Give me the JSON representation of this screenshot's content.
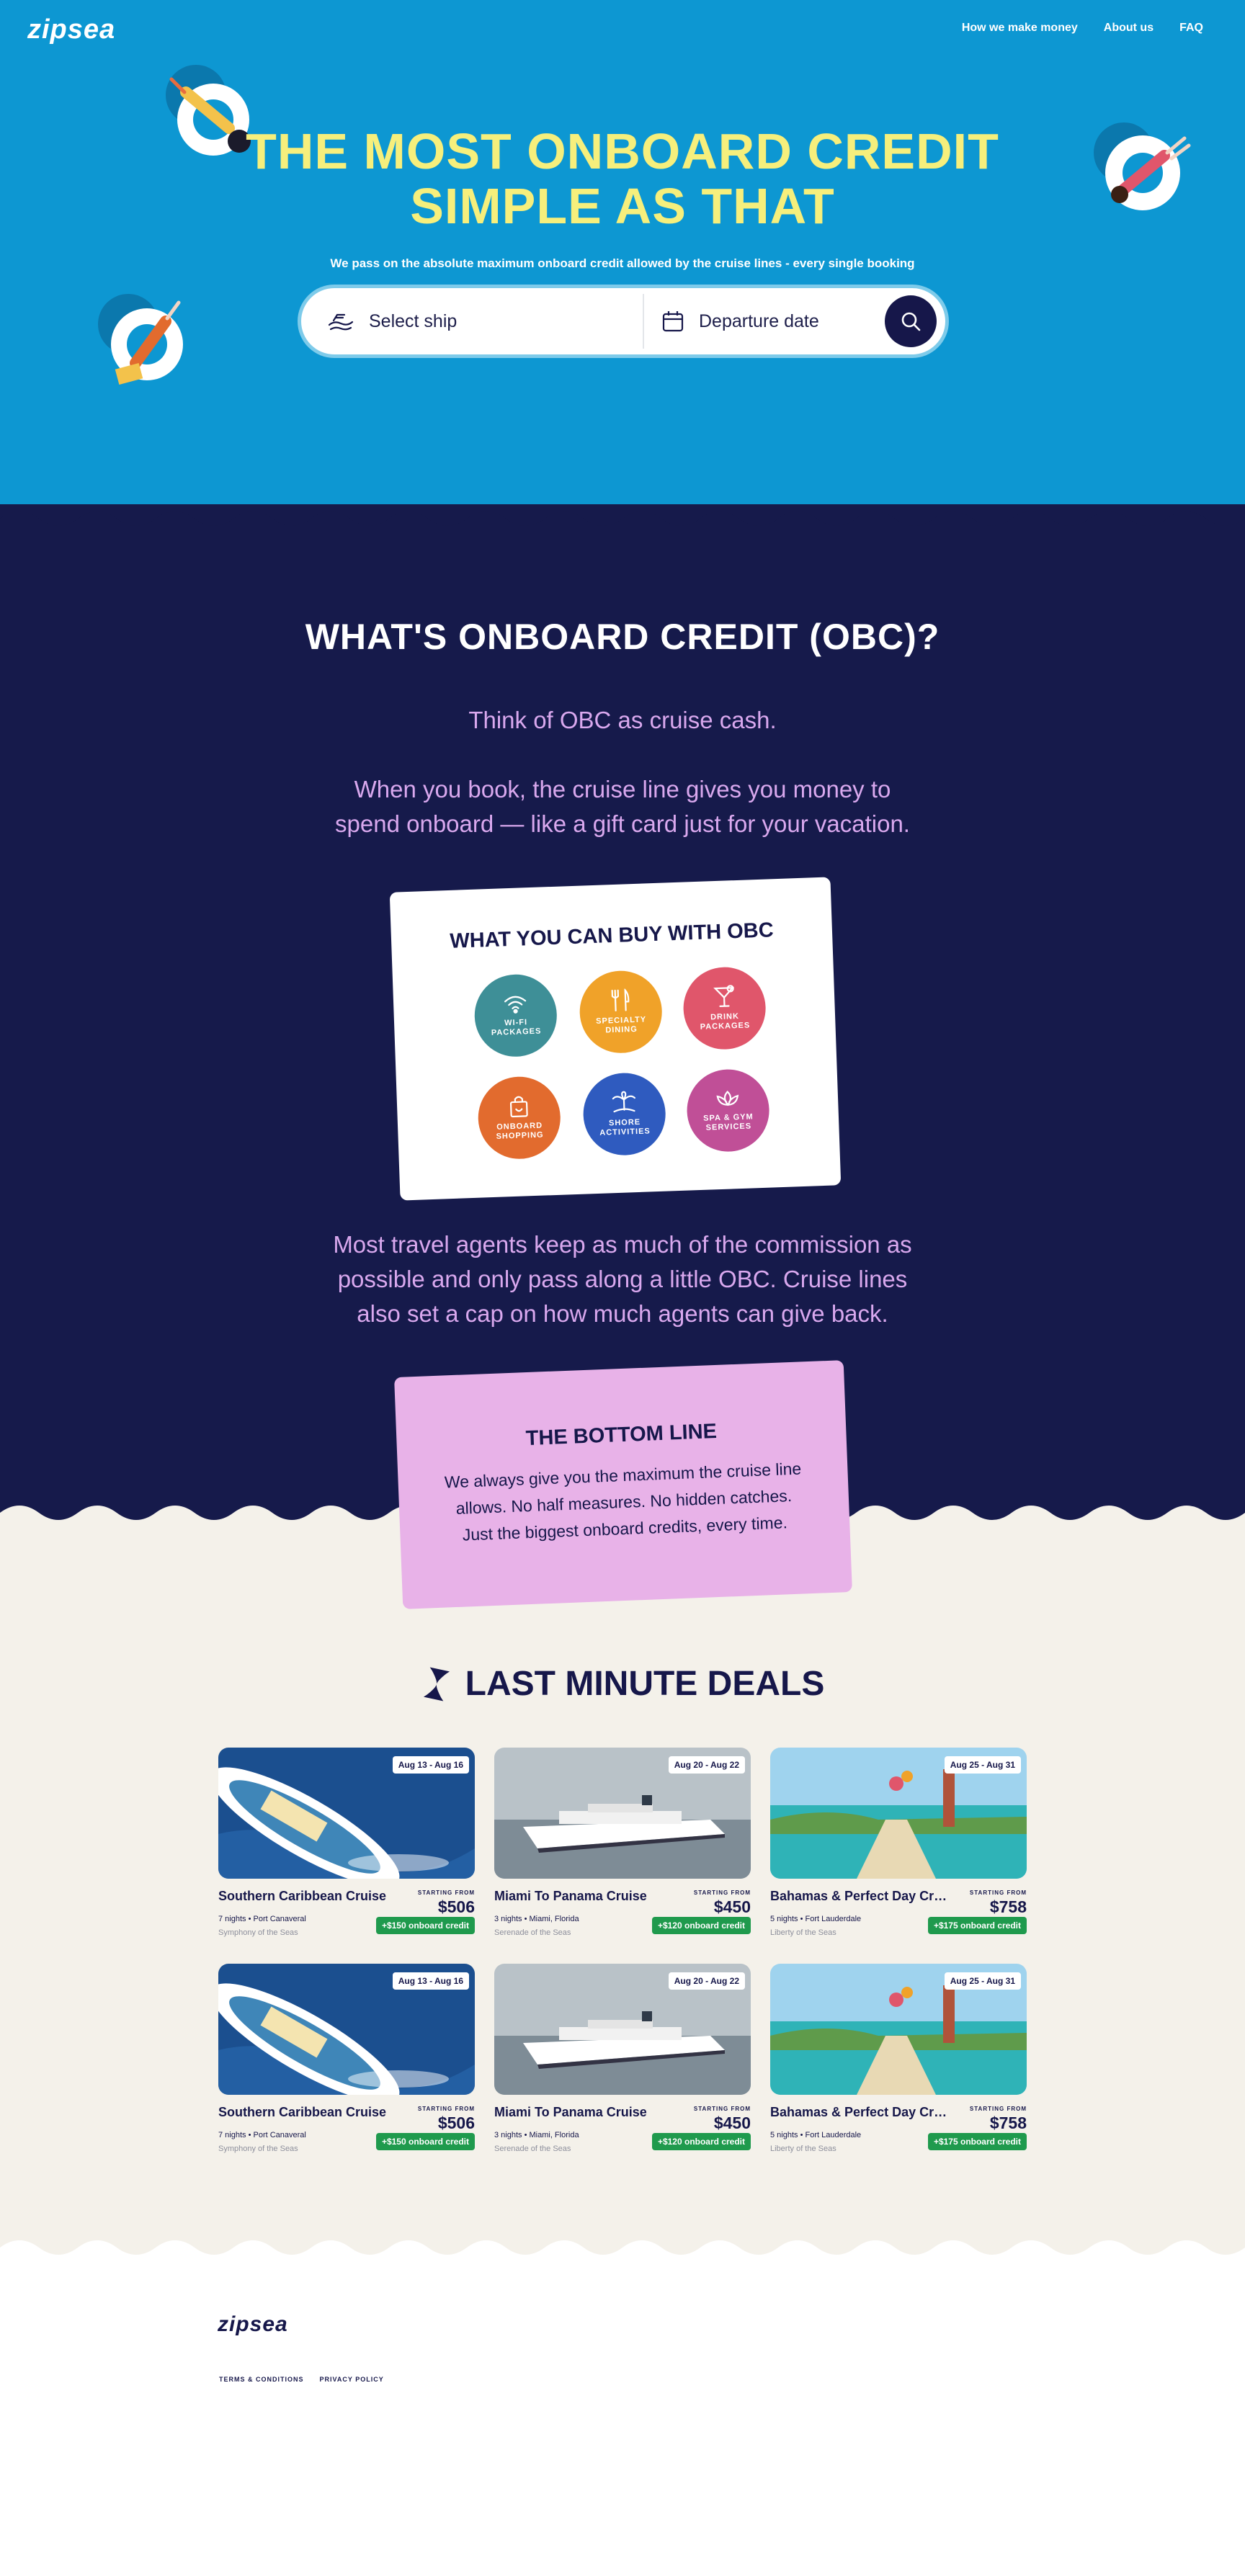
{
  "brand": {
    "logo": "zipsea"
  },
  "nav": {
    "items": [
      "How we make money",
      "About us",
      "FAQ"
    ]
  },
  "hero": {
    "title_line1": "THE MOST ONBOARD CREDIT",
    "title_line2": "SIMPLE AS THAT",
    "subtitle": "We pass on the absolute maximum onboard credit allowed by the cruise lines - every single booking",
    "search": {
      "ship_placeholder": "Select ship",
      "date_placeholder": "Departure date"
    }
  },
  "obc": {
    "title": "WHAT'S ONBOARD CREDIT (OBC)?",
    "line1": "Think of OBC as cruise cash.",
    "line2a": "When you book, the cruise line gives you money to",
    "line2b": "spend onboard — like a gift card just for your vacation.",
    "card_title": "WHAT YOU CAN BUY WITH OBC",
    "items": [
      {
        "line1": "WI-FI",
        "line2": "PACKAGES",
        "color": "#3e8f97",
        "icon": "wifi-icon"
      },
      {
        "line1": "SPECIALTY",
        "line2": "DINING",
        "color": "#f0a229",
        "icon": "cutlery-icon"
      },
      {
        "line1": "DRINK",
        "line2": "PACKAGES",
        "color": "#e0566b",
        "icon": "cocktail-icon"
      },
      {
        "line1": "ONBOARD",
        "line2": "SHOPPING",
        "color": "#e26b2e",
        "icon": "shopping-bag-icon"
      },
      {
        "line1": "SHORE",
        "line2": "ACTIVITIES",
        "color": "#2f5bbf",
        "icon": "palm-tree-icon"
      },
      {
        "line1": "SPA & GYM",
        "line2": "SERVICES",
        "color": "#c04f97",
        "icon": "lotus-icon"
      }
    ],
    "agents_line1": "Most travel agents keep as much of the commission as",
    "agents_line2": "possible and only pass along a little OBC. Cruise lines",
    "agents_line3": "also set a cap on how much agents can give back.",
    "bottom_title": "THE BOTTOM LINE",
    "bottom_line1": "We always give you the maximum the cruise line",
    "bottom_line2": "allows. No half measures. No hidden catches.",
    "bottom_line3": "Just the biggest onboard credits, every time."
  },
  "deals": {
    "title": "LAST MINUTE DEALS",
    "starting_label": "STARTING FROM",
    "items": [
      {
        "dates": "Aug 13 - Aug 16",
        "name": "Southern Caribbean Cruise",
        "price": "$506",
        "nights": "7 nights • Port Canaveral",
        "ship": "Symphony of the Seas",
        "credit": "+$150 onboard credit",
        "scene": "ship-topdown"
      },
      {
        "dates": "Aug 20 - Aug 22",
        "name": "Miami To Panama Cruise",
        "price": "$450",
        "nights": "3 nights • Miami, Florida",
        "ship": "Serenade of the Seas",
        "credit": "+$120 onboard credit",
        "scene": "ship-side"
      },
      {
        "dates": "Aug 25 - Aug 31",
        "name": "Bahamas & Perfect Day Cru...",
        "price": "$758",
        "nights": "5 nights • Fort Lauderdale",
        "ship": "Liberty of the Seas",
        "credit": "+$175 onboard credit",
        "scene": "island"
      },
      {
        "dates": "Aug 13 - Aug 16",
        "name": "Southern Caribbean Cruise",
        "price": "$506",
        "nights": "7 nights • Port Canaveral",
        "ship": "Symphony of the Seas",
        "credit": "+$150 onboard credit",
        "scene": "ship-topdown"
      },
      {
        "dates": "Aug 20 - Aug 22",
        "name": "Miami To Panama Cruise",
        "price": "$450",
        "nights": "3 nights • Miami, Florida",
        "ship": "Serenade of the Seas",
        "credit": "+$120 onboard credit",
        "scene": "ship-side"
      },
      {
        "dates": "Aug 25 - Aug 31",
        "name": "Bahamas & Perfect Day Cru...",
        "price": "$758",
        "nights": "5 nights • Fort Lauderdale",
        "ship": "Liberty of the Seas",
        "credit": "+$175 onboard credit",
        "scene": "island"
      }
    ]
  },
  "footer": {
    "logo": "zipsea",
    "links": [
      "TERMS & CONDITIONS",
      "PRIVACY POLICY"
    ]
  },
  "colors": {
    "hero_blue": "#0d97d2",
    "navy": "#161a4b",
    "yellow": "#f6ef7c",
    "lavender": "#d9a8ee",
    "pink_card": "#e8b2e8",
    "cream": "#f4f1ea",
    "green_badge": "#1f9a4d"
  }
}
